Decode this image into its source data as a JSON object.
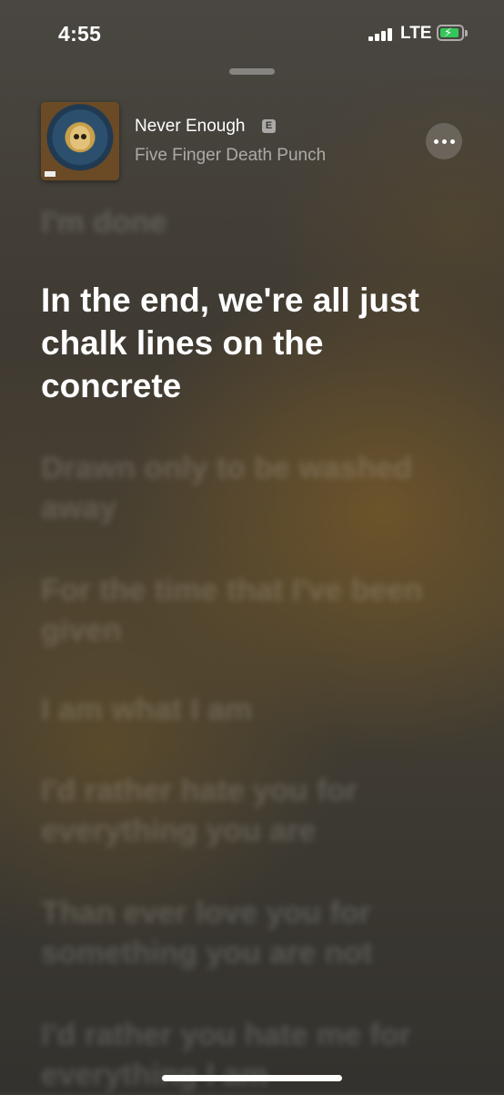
{
  "status_bar": {
    "time": "4:55",
    "network": "LTE"
  },
  "now_playing": {
    "title": "Never Enough",
    "explicit_badge": "E",
    "artist": "Five Finger Death Punch"
  },
  "lyrics": {
    "previous": "I'm done",
    "current": "In the end, we're all just chalk lines on the concrete",
    "upcoming": [
      "Drawn only to be washed away",
      "For the time that I've been given",
      "I am what I am",
      "I'd rather hate you for everything you are",
      "Than ever love you for something you are not",
      "I'd rather you hate me for everything I am"
    ]
  },
  "colors": {
    "battery_charging": "#34c759"
  }
}
